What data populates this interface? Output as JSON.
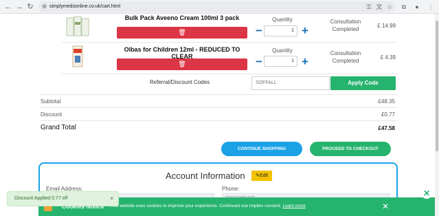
{
  "browser": {
    "url": "simplymedsonline.co.uk/cart.html",
    "icons": [
      "back-icon",
      "forward-icon",
      "reload-icon",
      "tune-icon",
      "password-key-icon",
      "translate-icon",
      "bookmark-star-icon",
      "extensions-icon",
      "profile-icon",
      "menu-icon"
    ]
  },
  "cart": {
    "quantity_label": "Quantity",
    "consultation_label": "Consultation Completed",
    "items": [
      {
        "name": "Bulk Pack Aveeno Cream 100ml 3 pack",
        "quantity": "1",
        "price": "£ 14.99"
      },
      {
        "name": "Olbas for Children 12ml - REDUCED TO CLEAR",
        "quantity": "1",
        "price": "£ 4.39"
      }
    ],
    "referral_label": "Referral/Discount Codes",
    "coupon_value": "SOFFALL",
    "apply_label": "Apply Code"
  },
  "totals": {
    "subtotal_label": "Subtotal",
    "subtotal": "£48.35",
    "discount_label": "Discount",
    "discount": "£0.77",
    "grand_label": "Grand Total",
    "grand": "£47.58"
  },
  "actions": {
    "continue": "CONTINUE SHOPPING",
    "checkout": "PROCEED TO CHECKOUT"
  },
  "account": {
    "title": "Account Information",
    "edit": "Edit",
    "email_label": "Email Address:",
    "phone_label": "Phone:",
    "phone_value": "07947265778"
  },
  "cookie": {
    "title": "Cookies Notice",
    "text": "This website uses cookies to improve your experience. Continued use implies consent.",
    "link": "Learn more",
    "close": "✕"
  },
  "toast": {
    "text": "Discount Applied 0.77 off",
    "close": "×"
  },
  "colors": {
    "accent_blue": "#1aa1e6",
    "accent_green": "#26b36e",
    "danger": "#dc3545"
  }
}
